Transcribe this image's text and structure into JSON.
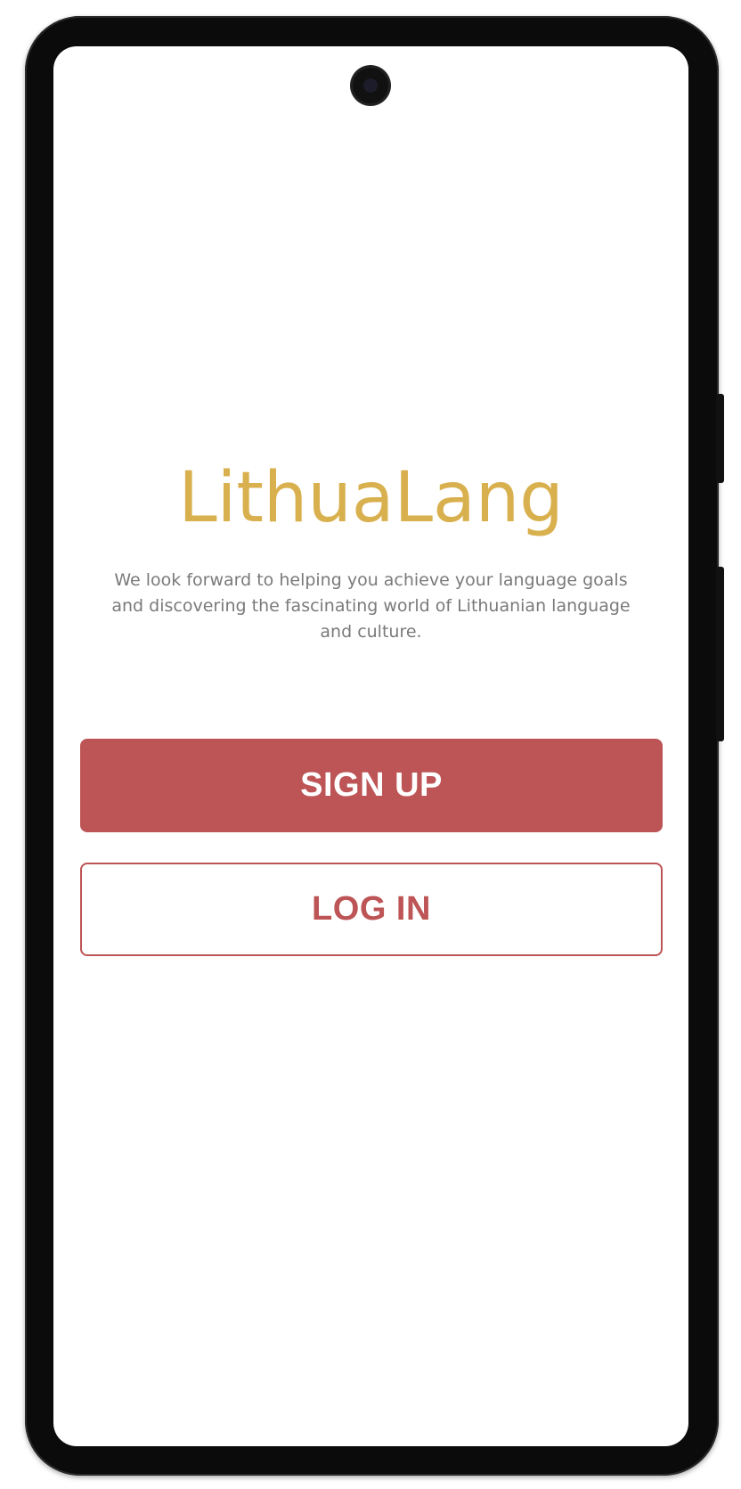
{
  "app": {
    "name": "LithuaLang",
    "tagline": "We look forward to helping you achieve your language goals and discovering the fascinating world of Lithuanian language and culture."
  },
  "actions": {
    "signup_label": "SIGN UP",
    "login_label": "LOG IN"
  },
  "colors": {
    "brand": "#d9b04e",
    "accent": "#bd5455",
    "text_muted": "#7a7a7a",
    "background": "#ffffff",
    "device_frame": "#0b0b0b"
  },
  "icons": {
    "camera": "front-camera-icon"
  }
}
